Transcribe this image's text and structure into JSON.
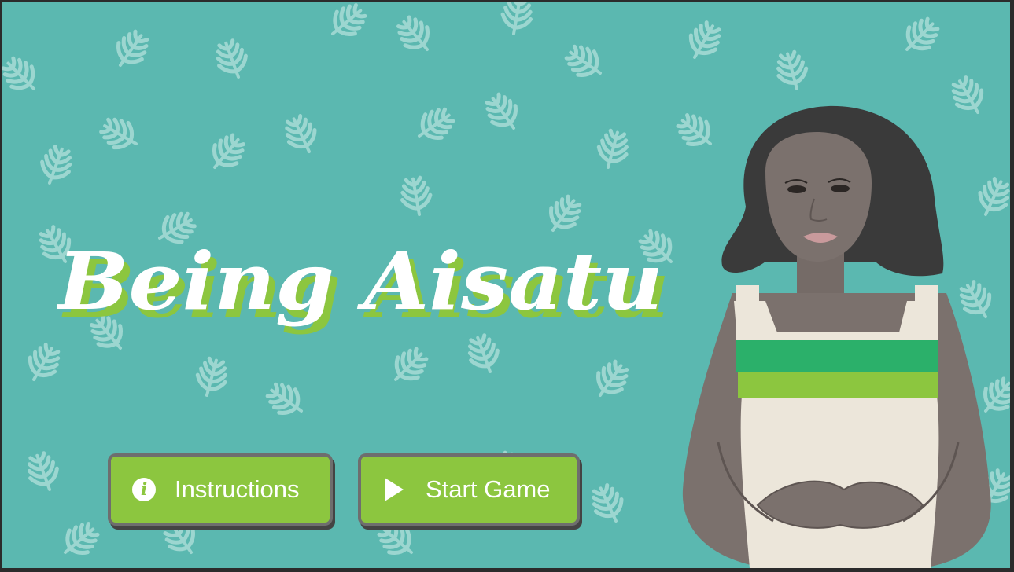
{
  "game": {
    "title": "Being Aisatu",
    "buttons": {
      "instructions": {
        "label": "Instructions",
        "icon": "info-icon"
      },
      "start": {
        "label": "Start Game",
        "icon": "play-icon"
      }
    }
  },
  "colors": {
    "background": "#5bb8b0",
    "leaf": "#a8dcd6",
    "button": "#8cc63f",
    "title_text": "#ffffff",
    "title_shadow": "#8cc63f",
    "dress": "#ece6da",
    "stripe_dark": "#2bb06a",
    "stripe_light": "#8cc63f",
    "skin": "#7b716d",
    "hair": "#3a3a3a"
  }
}
